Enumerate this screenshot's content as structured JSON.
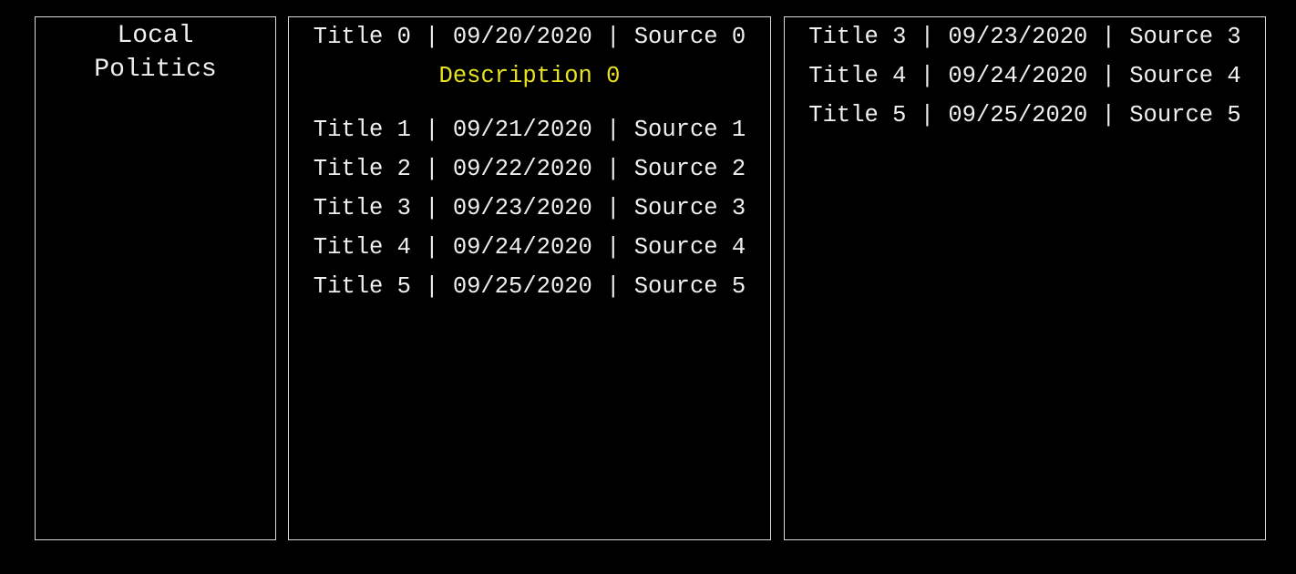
{
  "colors": {
    "background": "#000000",
    "text": "#f0f0f0",
    "border": "#d9d9d9",
    "description": "#e8e31e"
  },
  "category_panel": {
    "title_line1": "Local",
    "title_line2": "Politics"
  },
  "feed_panel": {
    "items": [
      {
        "text": "Title 0 | 09/20/2020 | Source 0",
        "description": "Description 0"
      },
      {
        "text": "Title 1 | 09/21/2020 | Source 1"
      },
      {
        "text": "Title 2 | 09/22/2020 | Source 2"
      },
      {
        "text": "Title 3 | 09/23/2020 | Source 3"
      },
      {
        "text": "Title 4 | 09/24/2020 | Source 4"
      },
      {
        "text": "Title 5 | 09/25/2020 | Source 5"
      }
    ]
  },
  "secondary_panel": {
    "items": [
      {
        "text": "Title 3 | 09/23/2020 | Source 3"
      },
      {
        "text": "Title 4 | 09/24/2020 | Source 4"
      },
      {
        "text": "Title 5 | 09/25/2020 | Source 5"
      }
    ]
  }
}
